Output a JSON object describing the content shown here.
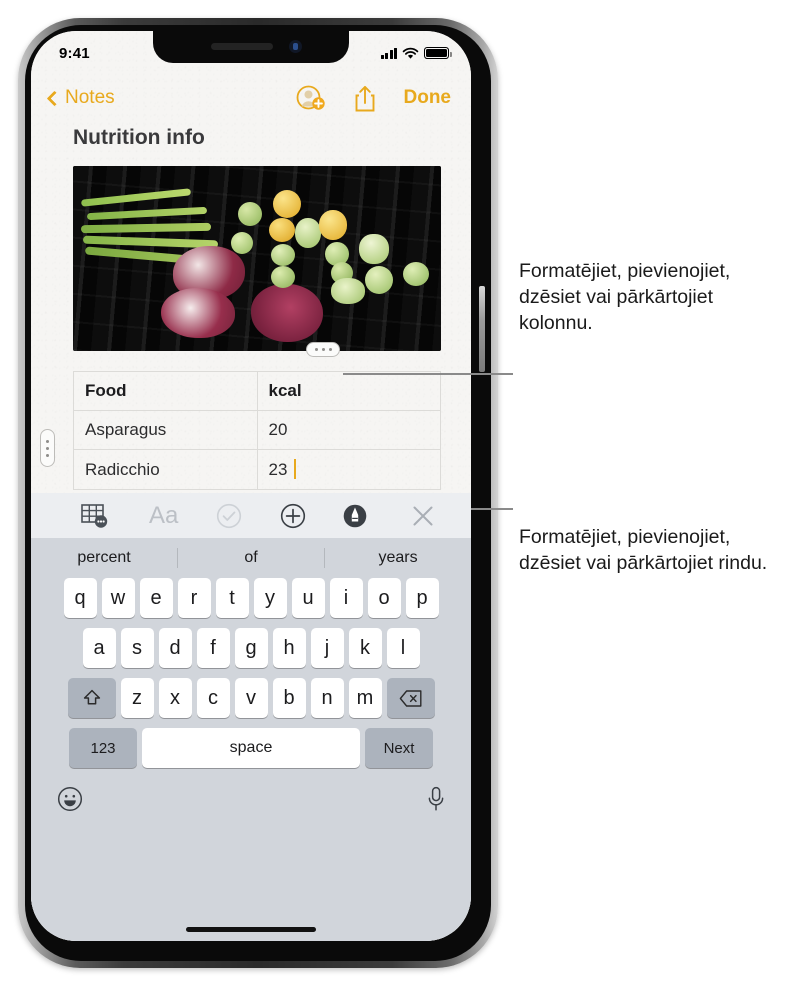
{
  "status_bar": {
    "time": "9:41",
    "icons": [
      "cellular-signal-icon",
      "wifi-icon",
      "battery-icon"
    ]
  },
  "nav_bar": {
    "back_label": "Notes",
    "back_icon": "chevron-left-icon",
    "add_person_icon": "add-person-icon",
    "share_icon": "share-icon",
    "done_label": "Done",
    "accent_color": "#e8a91d"
  },
  "note": {
    "title": "Nutrition info",
    "photo_alt": "grilled-vegetables-photo",
    "table": {
      "headers": [
        "Food",
        "kcal"
      ],
      "rows": [
        [
          "Asparagus",
          "20"
        ],
        [
          "Radicchio",
          "23"
        ]
      ],
      "cursor_cell": "23",
      "column_handle_icon": "column-handle-dots-icon",
      "row_handle_icon": "row-handle-dots-icon"
    }
  },
  "format_toolbar": {
    "items": [
      {
        "name": "table-icon",
        "label": "",
        "state": "active"
      },
      {
        "name": "text-format-icon",
        "label": "Aa",
        "state": "disabled"
      },
      {
        "name": "checklist-icon",
        "label": "",
        "state": "disabled"
      },
      {
        "name": "add-attachment-icon",
        "label": "",
        "state": "enabled"
      },
      {
        "name": "markup-pen-icon",
        "label": "",
        "state": "enabled"
      },
      {
        "name": "close-icon",
        "label": "",
        "state": "enabled"
      }
    ]
  },
  "keyboard": {
    "predictions": [
      "percent",
      "of",
      "years"
    ],
    "row1": [
      "q",
      "w",
      "e",
      "r",
      "t",
      "y",
      "u",
      "i",
      "o",
      "p"
    ],
    "row2": [
      "a",
      "s",
      "d",
      "f",
      "g",
      "h",
      "j",
      "k",
      "l"
    ],
    "row3": [
      "z",
      "x",
      "c",
      "v",
      "b",
      "n",
      "m"
    ],
    "shift_icon": "shift-arrow-icon",
    "backspace_icon": "backspace-icon",
    "numeric_label": "123",
    "space_label": "space",
    "return_label": "Next",
    "emoji_icon": "emoji-smiley-icon",
    "dictation_icon": "microphone-icon"
  },
  "callouts": {
    "column": "Formatējiet, pievienojiet, dzēsiet vai pārkārtojiet kolonnu.",
    "row": "Formatējiet, pievienojiet, dzēsiet vai pārkārtojiet rindu."
  }
}
